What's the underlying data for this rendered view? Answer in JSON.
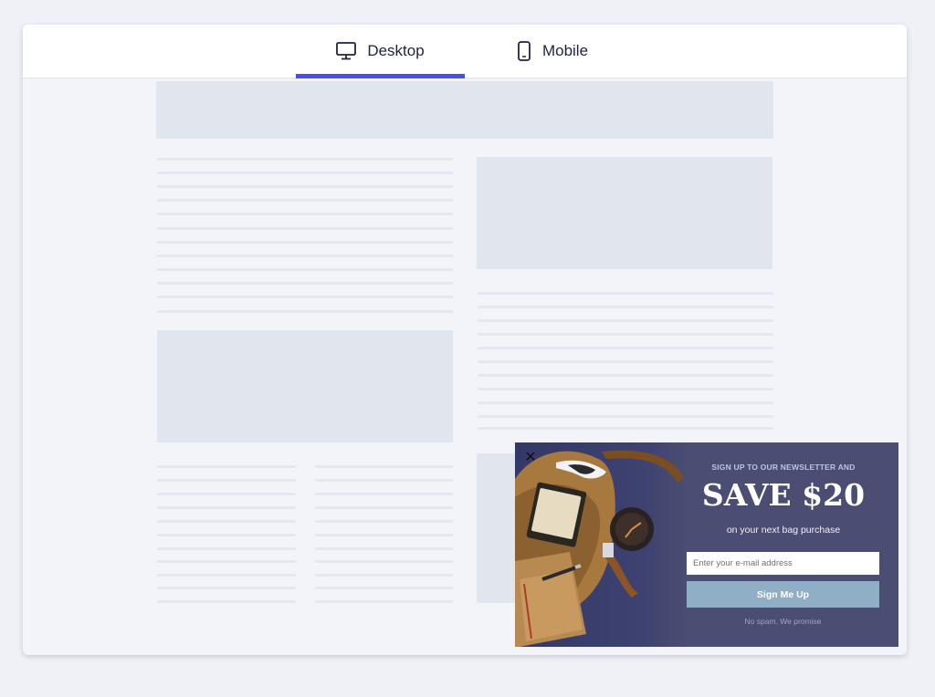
{
  "tabs": {
    "desktop_label": "Desktop",
    "mobile_label": "Mobile",
    "active": "desktop",
    "desktop_icon": "monitor-icon",
    "mobile_icon": "phone-icon",
    "accent_color": "#4a50e6"
  },
  "popup": {
    "close_label": "✕",
    "kicker": "SIGN UP TO OUR NEWSLETTER AND",
    "headline": "SAVE $20",
    "subtext": "on your next bag purchase",
    "email_placeholder": "Enter your e-mail address",
    "button_label": "Sign Me Up",
    "disclaimer": "No spam. We promise",
    "background_color": "#4b4e72",
    "button_color": "#8fafc7"
  }
}
